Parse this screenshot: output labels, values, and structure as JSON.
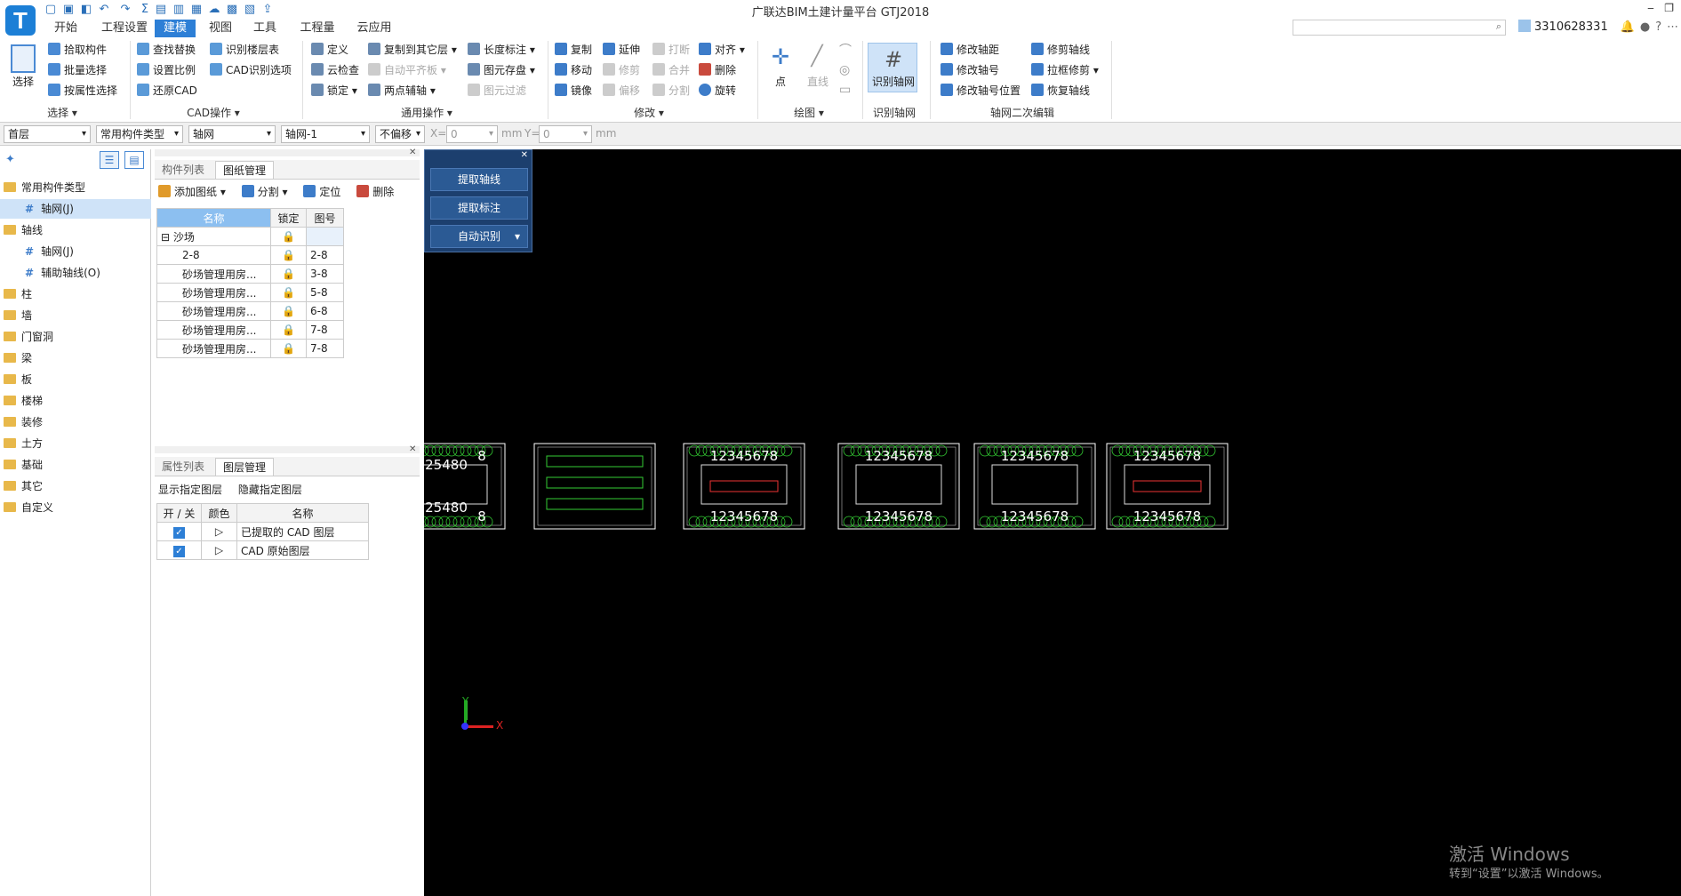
{
  "title": "广联达BIM土建计量平台 GTJ2018",
  "logo_letter": "T",
  "menu": [
    "开始",
    "工程设置",
    "建模",
    "视图",
    "工具",
    "工程量",
    "云应用"
  ],
  "user": "3310628331",
  "ribbon": {
    "select": {
      "label": "选择",
      "group": "选择 ▾",
      "items": [
        "拾取构件",
        "批量选择",
        "按属性选择"
      ]
    },
    "cad": {
      "group": "CAD操作 ▾",
      "col1": [
        "查找替换",
        "设置比例",
        "还原CAD"
      ],
      "col2": [
        "识别楼层表",
        "CAD识别选项"
      ]
    },
    "general": {
      "group": "通用操作 ▾",
      "col1": [
        "定义",
        "云检查",
        "锁定 ▾"
      ],
      "col2": [
        "复制到其它层 ▾",
        "自动平齐板 ▾",
        "两点辅轴 ▾"
      ],
      "col3": [
        "长度标注 ▾",
        "图元存盘 ▾",
        "图元过滤"
      ]
    },
    "modify": {
      "group": "修改 ▾",
      "col1": [
        "复制",
        "移动",
        "镜像"
      ],
      "col2": [
        "延伸",
        "修剪",
        "偏移"
      ],
      "col3": [
        "打断",
        "合并",
        "分割"
      ],
      "col4": [
        "对齐 ▾",
        "删除",
        "旋转"
      ]
    },
    "draw": {
      "group": "绘图 ▾",
      "point": "点",
      "line": "直线"
    },
    "identify": {
      "group": "识别轴网",
      "btn": "识别轴网"
    },
    "axisedit": {
      "group": "轴网二次编辑",
      "col1": [
        "修改轴距",
        "修改轴号",
        "修改轴号位置"
      ],
      "col2": [
        "修剪轴线",
        "拉框修剪 ▾",
        "恢复轴线"
      ]
    }
  },
  "toolbar2": {
    "floor": "首层",
    "type": "常用构件类型",
    "category": "轴网",
    "instance": "轴网-1",
    "offset": "不偏移",
    "x_label": "X=",
    "x_value": "0",
    "y_label": "Y=",
    "y_value": "0",
    "unit": "mm"
  },
  "tree": [
    {
      "label": "常用构件类型",
      "level": 0,
      "folder": true
    },
    {
      "label": "轴网(J)",
      "level": 1,
      "selected": true
    },
    {
      "label": "轴线",
      "level": 0,
      "folder": true
    },
    {
      "label": "轴网(J)",
      "level": 1
    },
    {
      "label": "辅助轴线(O)",
      "level": 1
    },
    {
      "label": "柱",
      "level": 0,
      "folder": true
    },
    {
      "label": "墙",
      "level": 0,
      "folder": true
    },
    {
      "label": "门窗洞",
      "level": 0,
      "folder": true
    },
    {
      "label": "梁",
      "level": 0,
      "folder": true
    },
    {
      "label": "板",
      "level": 0,
      "folder": true
    },
    {
      "label": "楼梯",
      "level": 0,
      "folder": true
    },
    {
      "label": "装修",
      "level": 0,
      "folder": true
    },
    {
      "label": "土方",
      "level": 0,
      "folder": true
    },
    {
      "label": "基础",
      "level": 0,
      "folder": true
    },
    {
      "label": "其它",
      "level": 0,
      "folder": true
    },
    {
      "label": "自定义",
      "level": 0,
      "folder": true
    }
  ],
  "drawing_panel": {
    "tabs": [
      "构件列表",
      "图纸管理"
    ],
    "actions": [
      "添加图纸 ▾",
      "分割 ▾",
      "定位",
      "删除"
    ],
    "headers": [
      "名称",
      "锁定",
      "图号"
    ],
    "rows": [
      {
        "name": "沙场",
        "num": ""
      },
      {
        "name": "2-8",
        "num": "2-8"
      },
      {
        "name": "砂场管理用房...",
        "num": "3-8"
      },
      {
        "name": "砂场管理用房...",
        "num": "5-8"
      },
      {
        "name": "砂场管理用房...",
        "num": "6-8"
      },
      {
        "name": "砂场管理用房...",
        "num": "7-8"
      },
      {
        "name": "砂场管理用房...",
        "num": "7-8"
      }
    ]
  },
  "layer_panel": {
    "tabs": [
      "属性列表",
      "图层管理"
    ],
    "actions": [
      "显示指定图层",
      "隐藏指定图层"
    ],
    "headers": [
      "开 / 关",
      "颜色",
      "名称"
    ],
    "rows": [
      {
        "name": "已提取的 CAD 图层",
        "on": true
      },
      {
        "name": "CAD 原始图层",
        "on": true
      }
    ]
  },
  "identify_panel": {
    "buttons": [
      "提取轴线",
      "提取标注",
      "自动识别"
    ]
  },
  "canvas_labels": {
    "axis_nums": "12345678",
    "dim": "25480",
    "n1": "1",
    "n8": "8",
    "x": "X",
    "y": "Y"
  },
  "watermark": {
    "line1": "激活 Windows",
    "line2": "转到“设置”以激活 Windows。"
  }
}
